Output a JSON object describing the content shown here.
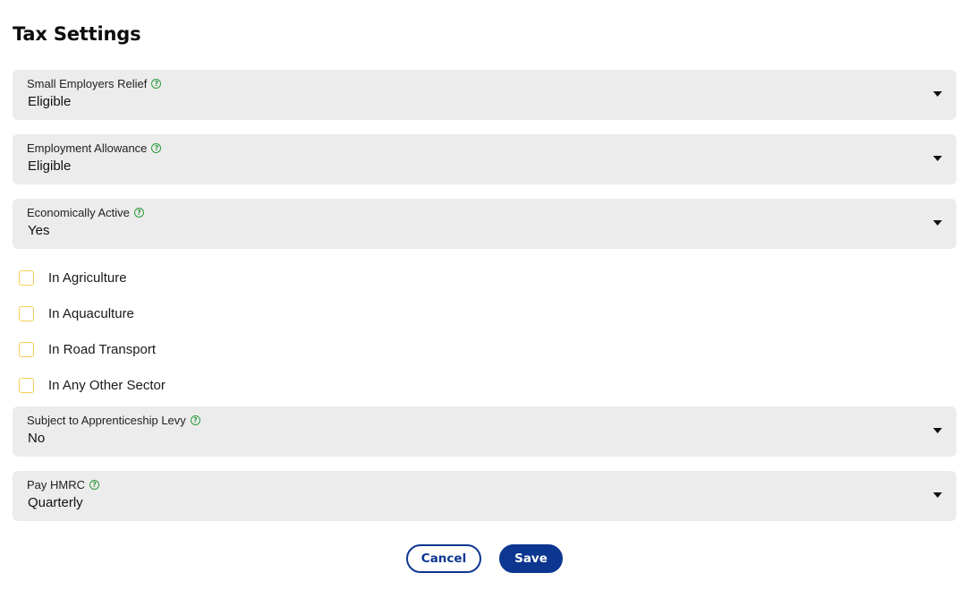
{
  "page": {
    "title": "Tax Settings"
  },
  "fields": [
    {
      "label": "Small Employers Relief",
      "value": "Eligible"
    },
    {
      "label": "Employment Allowance",
      "value": "Eligible"
    },
    {
      "label": "Economically Active",
      "value": "Yes"
    },
    {
      "label": "Subject to Apprenticeship Levy",
      "value": "No"
    },
    {
      "label": "Pay HMRC",
      "value": "Quarterly"
    }
  ],
  "help_icon_glyph": "?",
  "checkboxes": [
    {
      "label": "In Agriculture",
      "checked": false
    },
    {
      "label": "In Aquaculture",
      "checked": false
    },
    {
      "label": "In Road Transport",
      "checked": false
    },
    {
      "label": "In Any Other Sector",
      "checked": false
    }
  ],
  "actions": {
    "cancel_label": "Cancel",
    "save_label": "Save"
  },
  "colors": {
    "field_background": "#ececec",
    "help_icon": "#2e9a3c",
    "checkbox_border": "#f5cd57",
    "primary": "#0c3690"
  }
}
